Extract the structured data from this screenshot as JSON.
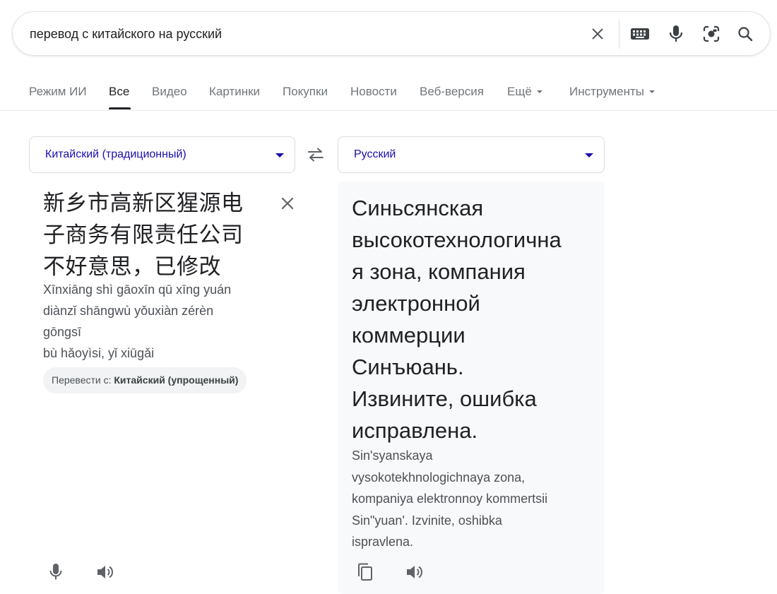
{
  "search": {
    "query": "перевод с китайского на русский",
    "icons": [
      "clear-icon",
      "keyboard-icon",
      "microphone-icon",
      "lens-icon",
      "search-icon"
    ]
  },
  "tabs": [
    {
      "label": "Режим ИИ",
      "active": false
    },
    {
      "label": "Все",
      "active": true
    },
    {
      "label": "Видео",
      "active": false
    },
    {
      "label": "Картинки",
      "active": false
    },
    {
      "label": "Покупки",
      "active": false
    },
    {
      "label": "Новости",
      "active": false
    },
    {
      "label": "Веб-версия",
      "active": false
    },
    {
      "label": "Ещё",
      "active": false,
      "dropdown": true
    },
    {
      "label": "Инструменты",
      "active": false,
      "dropdown": true
    }
  ],
  "translator": {
    "source_language": "Китайский (традиционный)",
    "target_language": "Русский",
    "source_text_lines": [
      "新乡市高新区猩源电",
      "子商务有限责任公司",
      "不好意思，已修改"
    ],
    "pinyin_lines": [
      "Xīnxiāng shì gāoxīn qū xīng yuán",
      "diànzǐ shāngwù yǒuxiàn zérèn",
      "gōngsī",
      "bù hǎoyìsi, yǐ xiūgǎi"
    ],
    "translate_from_prefix": "Перевести с:",
    "translate_from_language": "Китайский (упрощенный)",
    "target_text_lines": [
      "Синьсянская",
      "высокотехнологична",
      "я зона, компания",
      "электронной",
      "коммерции",
      "Синъюань.",
      "Извините, ошибка",
      "исправлена."
    ],
    "transliteration_lines": [
      "Sin'syanskaya",
      "vysokotekhnologichnaya zona,",
      "kompaniya elektronnoy kommertsii",
      "Sin\"yuan'. Izvinite, oshibka",
      "ispravlena."
    ]
  },
  "colors": {
    "link": "#1a0dab",
    "text": "#202124",
    "muted": "#70757a",
    "panel_bg": "#f8f9fa"
  }
}
